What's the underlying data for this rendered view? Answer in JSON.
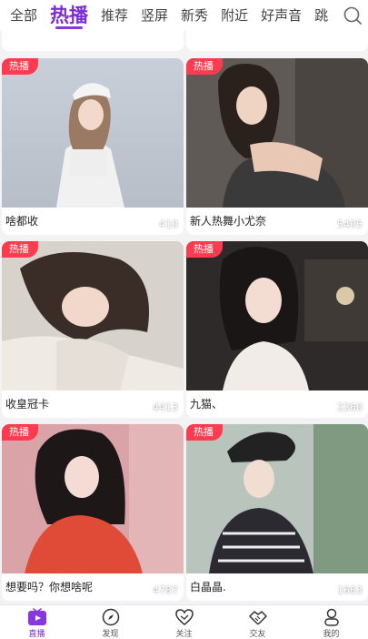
{
  "tabs": [
    {
      "label": "全部",
      "active": false
    },
    {
      "label": "热播",
      "active": true
    },
    {
      "label": "推荐",
      "active": false
    },
    {
      "label": "竖屏",
      "active": false
    },
    {
      "label": "新秀",
      "active": false
    },
    {
      "label": "附近",
      "active": false
    },
    {
      "label": "好声音",
      "active": false
    },
    {
      "label": "跳",
      "active": false
    }
  ],
  "search_icon": "search-icon",
  "cards": [
    {
      "badge": "热播",
      "viewers": "410",
      "title": "啥都收"
    },
    {
      "badge": "热播",
      "viewers": "5405",
      "title": "新人热舞小尤奈"
    },
    {
      "badge": "热播",
      "viewers": "4413",
      "title": "收皇冠卡"
    },
    {
      "badge": "热播",
      "viewers": "2260",
      "title": "九猫、"
    },
    {
      "badge": "热播",
      "viewers": "4787",
      "title": "想要吗？你想啥呢"
    },
    {
      "badge": "热播",
      "viewers": "1663",
      "title": "白晶晶."
    }
  ],
  "bottom_nav": [
    {
      "label": "直播",
      "icon": "tv-icon",
      "active": true
    },
    {
      "label": "发现",
      "icon": "compass-icon",
      "active": false
    },
    {
      "label": "关注",
      "icon": "heart-icon",
      "active": false
    },
    {
      "label": "交友",
      "icon": "handshake-icon",
      "active": false
    },
    {
      "label": "我的",
      "icon": "user-icon",
      "active": false
    }
  ],
  "colors": {
    "accent": "#7a2cd6",
    "badge": "#ff3b4f"
  }
}
